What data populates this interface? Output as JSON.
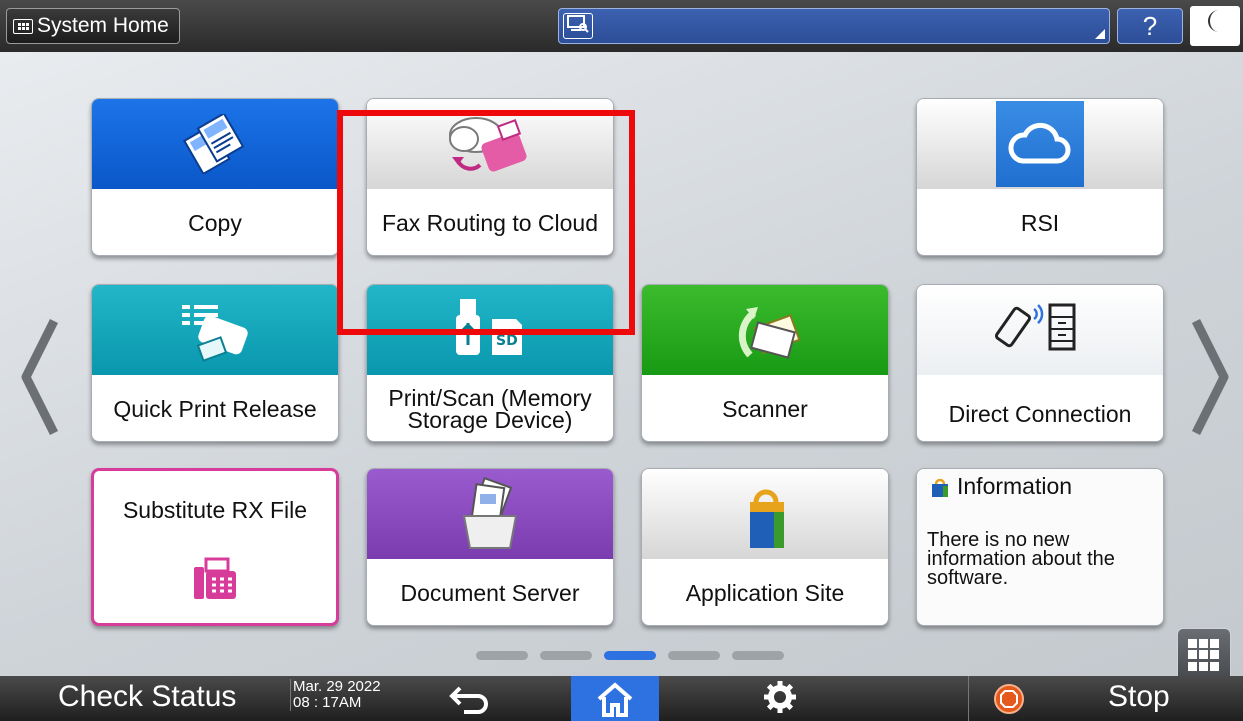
{
  "topbar": {
    "system_home_label": "System Home",
    "help_label": "?",
    "sleep_icon": "moon-icon"
  },
  "tiles": [
    {
      "label": "Copy",
      "color": "#1c74e8"
    },
    {
      "label": "Fax Routing to Cloud",
      "color": "#e0e0e0"
    },
    {
      "label": "RSI",
      "color": "#e0e0e0"
    },
    {
      "label": "Quick Print Release",
      "color": "#22b6c8"
    },
    {
      "label": "Print/Scan (Memory Storage Device)",
      "color": "#22b6c8"
    },
    {
      "label": "Scanner",
      "color": "#3cbb2d"
    },
    {
      "label": "Direct Connection",
      "color": "#ffffff"
    },
    {
      "label": "Substitute RX File",
      "color": "#d83c9b"
    },
    {
      "label": "Document Server",
      "color": "#9a5bcf"
    },
    {
      "label": "Application Site",
      "color": "#e0e0e0"
    }
  ],
  "information": {
    "title": "Information",
    "text": "There is no new information about the software."
  },
  "page_indicator": {
    "pages": 5,
    "current": 3
  },
  "bottombar": {
    "check_status": "Check Status",
    "date": "Mar. 29 2022",
    "time": "08 : 17AM",
    "stop_label": "Stop"
  },
  "colors": {
    "accent": "#2d72e0",
    "highlight": "#ee0a0a",
    "stop": "#e55a1c"
  }
}
